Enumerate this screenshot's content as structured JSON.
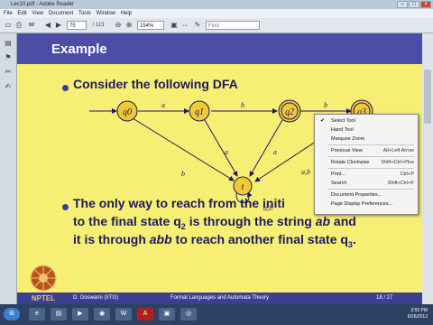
{
  "window": {
    "title": "Lec10.pdf - Adobe Reader"
  },
  "menu": [
    "File",
    "Edit",
    "View",
    "Document",
    "Tools",
    "Window",
    "Help"
  ],
  "toolbar": {
    "page": "75",
    "total_pages": "/ 113",
    "zoom": "154%",
    "find_placeholder": "Find"
  },
  "slide": {
    "title": "Example",
    "bullet1": "Consider the following DFA",
    "line2a": "The only way to reach from the initi",
    "line2b": "to the final state q",
    "line2c": "is through the string ",
    "line2d": "ab",
    "line2e": " and",
    "line3a": "it is through ",
    "line3b": "abb",
    "line3c": " to reach another final state q",
    "sub2": "2",
    "sub3": "3",
    "dot": "."
  },
  "dfa": {
    "states": [
      "q0",
      "q1",
      "q2",
      "q3",
      "t"
    ],
    "edge_labels": {
      "q0_q1": "a",
      "q1_q2": "b",
      "q2_q3": "b",
      "q0_t": "b",
      "q1_t": "a",
      "q2_t": "a",
      "q3_t": "a,b",
      "t_t": "a,b"
    }
  },
  "footer": {
    "author": "D. Goswami (IITG)",
    "course": "Formal Languages and Automata Theory",
    "page": "18 / 27"
  },
  "context_menu": [
    {
      "label": "Select Tool",
      "shortcut": "",
      "checked": true
    },
    {
      "label": "Hand Tool",
      "shortcut": "",
      "checked": false
    },
    {
      "label": "Marquee Zoom",
      "shortcut": "",
      "checked": false
    },
    {
      "label": "Previous View",
      "shortcut": "Alt+Left Arrow",
      "checked": false
    },
    {
      "label": "Rotate Clockwise",
      "shortcut": "Shift+Ctrl+Plus",
      "checked": false
    },
    {
      "label": "Print...",
      "shortcut": "Ctrl+P",
      "checked": false
    },
    {
      "label": "Search",
      "shortcut": "Shift+Ctrl+F",
      "checked": false
    },
    {
      "label": "Document Properties...",
      "shortcut": "",
      "checked": false
    },
    {
      "label": "Page Display Preferences...",
      "shortcut": "",
      "checked": false
    }
  ],
  "logo_text": "NPTEL",
  "clock": {
    "time": "3:55 PM",
    "date": "6/26/2013"
  },
  "colors": {
    "slide_bg": "#f7ef73",
    "header": "#4c4ea5",
    "state_fill": "#f0c838",
    "text": "#1c1a5e"
  }
}
